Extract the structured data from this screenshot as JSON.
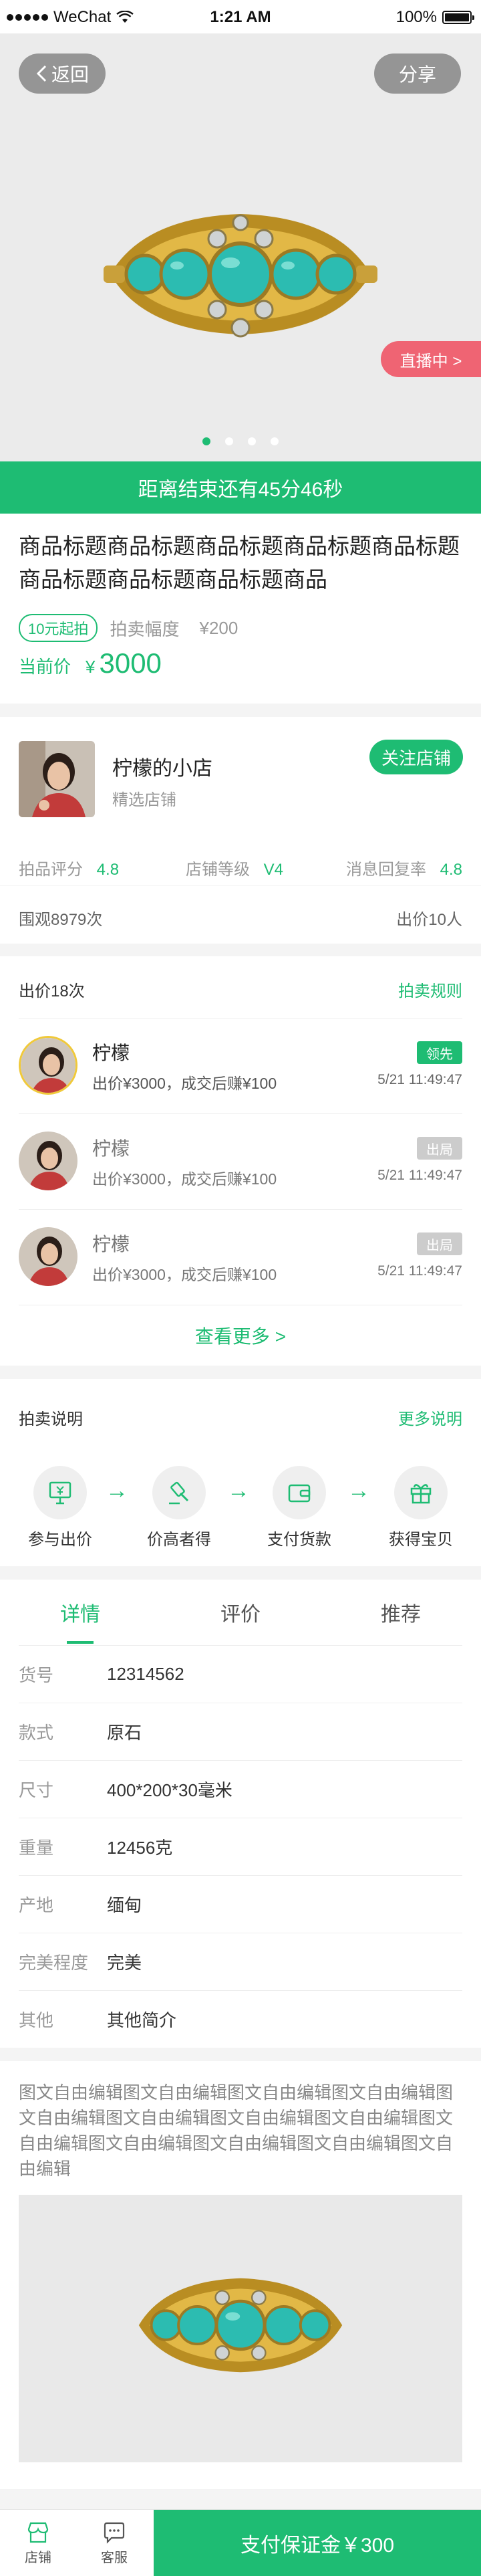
{
  "statusbar": {
    "carrier": "WeChat",
    "time": "1:21 AM",
    "battery": "100%"
  },
  "hero": {
    "back_label": "返回",
    "share_label": "分享",
    "live_label": "直播中 >",
    "dots_count": 4,
    "active_dot": 1
  },
  "countdown": "距离结束还有45分46秒",
  "product": {
    "title": "商品标题商品标题商品标题商品标题商品标题商品标题商品标题商品标题商品",
    "start_tag": "10元起拍",
    "increment_label": "拍卖幅度",
    "increment_value": "¥200",
    "current_label": "当前价",
    "currency": "¥",
    "current_price": "3000"
  },
  "shop": {
    "name": "柠檬的小店",
    "subtitle": "精选店铺",
    "follow_label": "关注店铺",
    "stats": [
      {
        "label": "拍品评分",
        "value": "4.8"
      },
      {
        "label": "店铺等级",
        "value": "V4"
      },
      {
        "label": "消息回复率",
        "value": "4.8"
      }
    ]
  },
  "views": {
    "watch": "围观8979次",
    "bidders": "出价10人"
  },
  "bids": {
    "header": "出价18次",
    "rules_link": "拍卖规则",
    "items": [
      {
        "name": "柠檬",
        "desc": "出价¥3000，成交后赚¥100",
        "badge": "领先",
        "time": "5/21 11:49:47"
      },
      {
        "name": "柠檬",
        "desc": "出价¥3000，成交后赚¥100",
        "badge": "出局",
        "time": "5/21 11:49:47"
      },
      {
        "name": "柠檬",
        "desc": "出价¥3000，成交后赚¥100",
        "badge": "出局",
        "time": "5/21 11:49:47"
      }
    ],
    "more_label": "查看更多 >"
  },
  "process": {
    "title": "拍卖说明",
    "more_label": "更多说明",
    "steps": [
      "参与出价",
      "价高者得",
      "支付货款",
      "获得宝贝"
    ]
  },
  "tabs": [
    "详情",
    "评价",
    "推荐"
  ],
  "details": [
    {
      "k": "货号",
      "v": "12314562"
    },
    {
      "k": "款式",
      "v": "原石"
    },
    {
      "k": "尺寸",
      "v": "400*200*30毫米"
    },
    {
      "k": "重量",
      "v": "12456克"
    },
    {
      "k": "产地",
      "v": "缅甸"
    },
    {
      "k": "完美程度",
      "v": "完美"
    },
    {
      "k": "其他",
      "v": "其他简介"
    }
  ],
  "free_text": "图文自由编辑图文自由编辑图文自由编辑图文自由编辑图文自由编辑图文自由编辑图文自由编辑图文自由编辑图文自由编辑图文自由编辑图文自由编辑图文自由编辑图文自由编辑",
  "bottombar": {
    "shop_label": "店铺",
    "service_label": "客服",
    "pay_label": "支付保证金￥300"
  },
  "colors": {
    "accent": "#1ebc73",
    "live": "#ef6473",
    "badge_out": "#cccccc"
  },
  "icons": [
    "back-chevron-icon",
    "wifi-icon",
    "battery-icon",
    "bid-card-icon",
    "gavel-icon",
    "wallet-icon",
    "gift-icon",
    "shop-icon",
    "chat-icon"
  ]
}
